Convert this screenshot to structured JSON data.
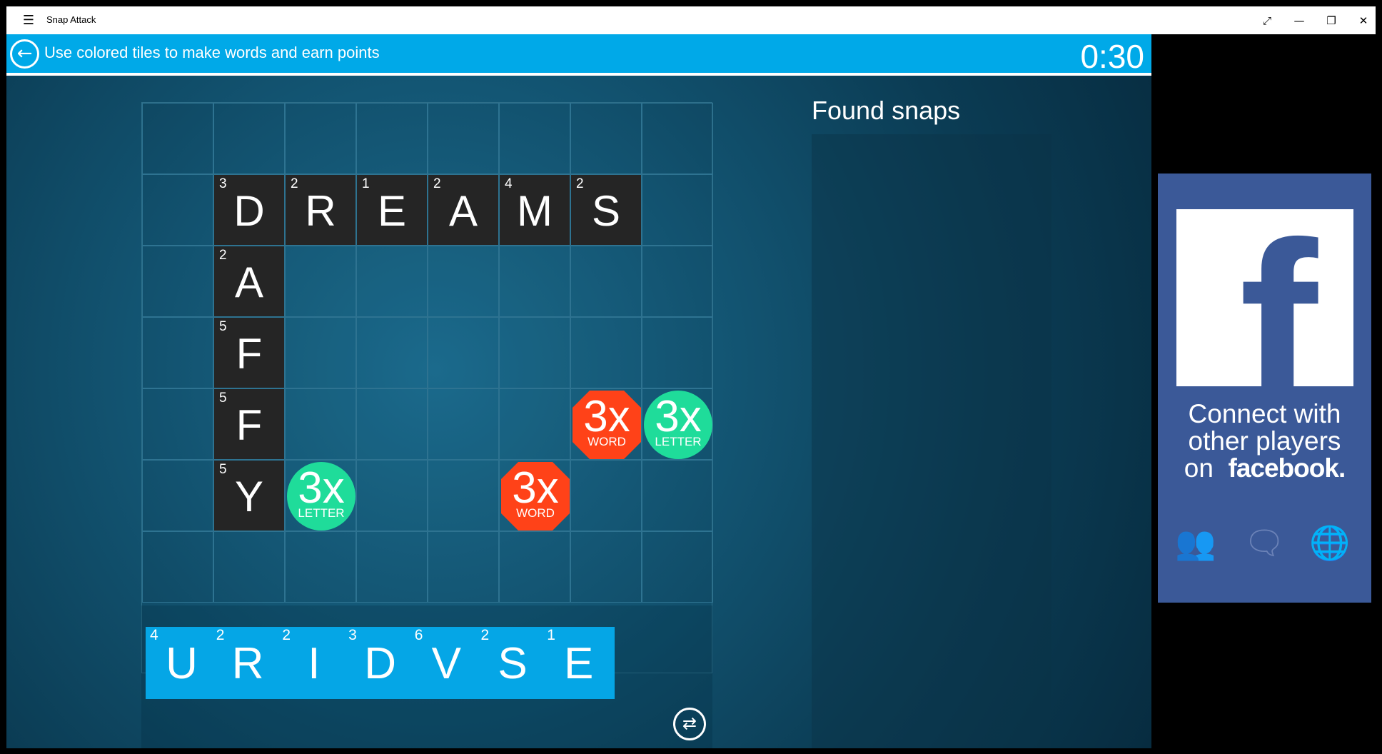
{
  "window": {
    "title": "Snap Attack",
    "menu_icon": "hamburger-icon",
    "controls": [
      "expand-icon",
      "minimize-icon",
      "restore-icon",
      "close-icon"
    ]
  },
  "header": {
    "instruction": "Use colored tiles to make words and earn points",
    "timer": "0:30",
    "back_icon": "arrow-left-icon"
  },
  "board": {
    "columns": 8,
    "rows": 7,
    "tiles": [
      {
        "row": 1,
        "col": 1,
        "letter": "D",
        "points": "3"
      },
      {
        "row": 1,
        "col": 2,
        "letter": "R",
        "points": "2"
      },
      {
        "row": 1,
        "col": 3,
        "letter": "E",
        "points": "1"
      },
      {
        "row": 1,
        "col": 4,
        "letter": "A",
        "points": "2"
      },
      {
        "row": 1,
        "col": 5,
        "letter": "M",
        "points": "4"
      },
      {
        "row": 1,
        "col": 6,
        "letter": "S",
        "points": "2"
      },
      {
        "row": 2,
        "col": 1,
        "letter": "A",
        "points": "2"
      },
      {
        "row": 3,
        "col": 1,
        "letter": "F",
        "points": "5"
      },
      {
        "row": 4,
        "col": 1,
        "letter": "F",
        "points": "5"
      },
      {
        "row": 5,
        "col": 1,
        "letter": "Y",
        "points": "5"
      }
    ],
    "bonuses": [
      {
        "row": 4,
        "col": 6,
        "mult": "3x",
        "label": "WORD",
        "type": "word",
        "color": "#ff4218"
      },
      {
        "row": 4,
        "col": 7,
        "mult": "3x",
        "label": "LETTER",
        "type": "letter",
        "color": "#1fdc9a"
      },
      {
        "row": 5,
        "col": 2,
        "mult": "3x",
        "label": "LETTER",
        "type": "letter",
        "color": "#1fdc9a"
      },
      {
        "row": 5,
        "col": 5,
        "mult": "3x",
        "label": "WORD",
        "type": "word",
        "color": "#ff4218"
      }
    ]
  },
  "rack": [
    {
      "letter": "U",
      "points": "4"
    },
    {
      "letter": "R",
      "points": "2"
    },
    {
      "letter": "I",
      "points": "2"
    },
    {
      "letter": "D",
      "points": "3"
    },
    {
      "letter": "V",
      "points": "6"
    },
    {
      "letter": "S",
      "points": "2"
    },
    {
      "letter": "E",
      "points": "1"
    }
  ],
  "shuffle_icon": "shuffle-icon",
  "found": {
    "title": "Found snaps",
    "items": []
  },
  "ad": {
    "logo": "f",
    "line1": "Connect with",
    "line2": "other players",
    "line3_prefix": "on",
    "brand": "facebook",
    "brand_suffix": ".",
    "icons": [
      "people-icon",
      "chat-icon",
      "globe-icon"
    ]
  },
  "colors": {
    "header": "#00a9e8",
    "board_tile": "#252525",
    "rack_tile": "#05a6e6",
    "facebook": "#3b5998"
  }
}
